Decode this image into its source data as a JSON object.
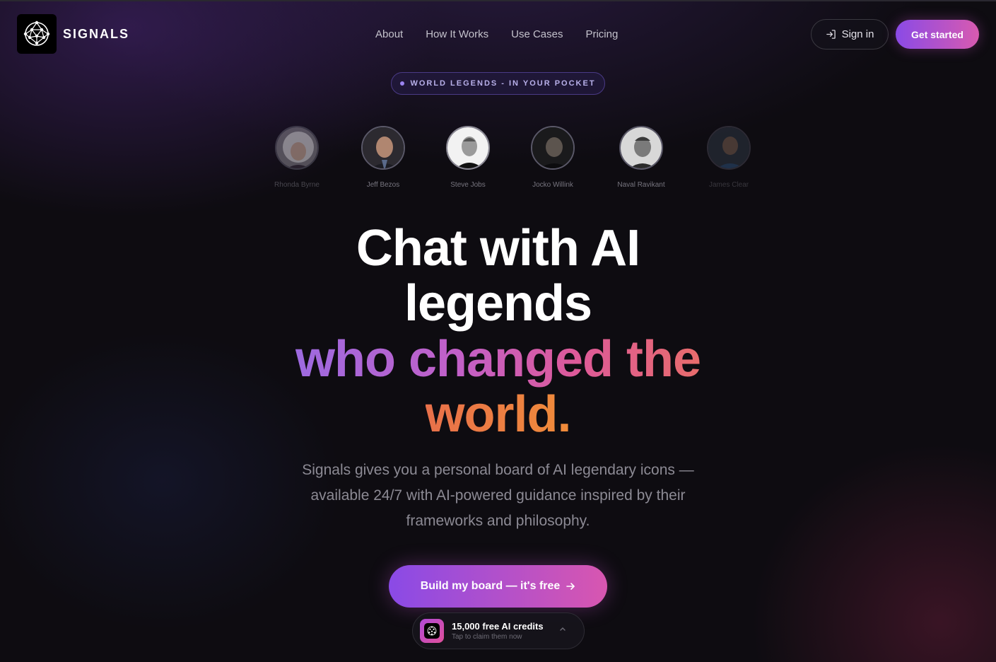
{
  "header": {
    "brand": "SIGNALS",
    "nav": [
      "About",
      "How It Works",
      "Use Cases",
      "Pricing"
    ],
    "signin_label": "Sign in",
    "get_started_label": "Get started"
  },
  "badge": {
    "text": "WORLD LEGENDS - IN YOUR POCKET"
  },
  "legends": [
    {
      "name": "Rhonda Byrne"
    },
    {
      "name": "Jeff Bezos"
    },
    {
      "name": "Steve Jobs"
    },
    {
      "name": "Jocko Willink"
    },
    {
      "name": "Naval Ravikant"
    },
    {
      "name": "James Clear"
    }
  ],
  "hero": {
    "line1": "Chat with AI",
    "line2": "legends",
    "line3": "who changed the",
    "line4": "world."
  },
  "subtitle": {
    "line1": "Signals gives you a personal board of AI legendary icons —",
    "line2": "available 24/7 with AI-powered guidance inspired by their",
    "line3": "frameworks and philosophy."
  },
  "cta": {
    "label": "Build my board — it's free"
  },
  "credits": {
    "title": "15,000 free AI credits",
    "subtitle": "Tap to claim them now"
  },
  "colors": {
    "accent_start": "#8a4ae6",
    "accent_end": "#d856b0",
    "gradient_orange": "#f08c3a"
  }
}
